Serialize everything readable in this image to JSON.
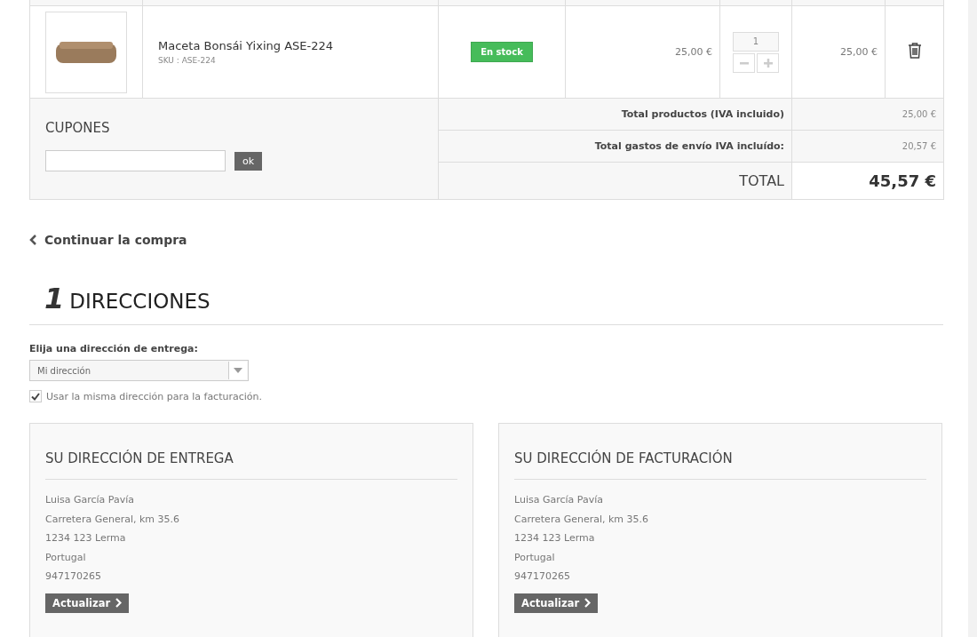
{
  "cart": {
    "items": [
      {
        "name": "Maceta Bonsái Yixing ASE-224",
        "sku": "SKU : ASE-224",
        "stock": "En stock",
        "unit_price": "25,00 €",
        "quantity": "1",
        "total": "25,00 €"
      }
    ],
    "coupons": {
      "title": "CUPONES",
      "button": "ok"
    },
    "totals": [
      {
        "kind": "line",
        "label": "Total productos (IVA incluido)",
        "value": "25,00 €"
      },
      {
        "kind": "line",
        "label": "Total gastos de envío IVA incluído:",
        "value": "20,57 €"
      },
      {
        "kind": "grand",
        "label": "TOTAL",
        "value": "45,57 €"
      }
    ]
  },
  "continue_link": "Continuar la compra",
  "section": {
    "number": "1",
    "title": "DIRECCIONES"
  },
  "delivery_select": {
    "label": "Elija una dirección de entrega:",
    "value": "Mi dirección"
  },
  "same_billing": {
    "label": "Usar la misma dirección para la facturación.",
    "checked": true
  },
  "addresses": [
    {
      "title": "SU DIRECCIÓN DE ENTREGA",
      "lines": [
        "Luisa García Pavía",
        "Carretera General, km 35.6",
        "1234 123 Lerma",
        "Portugal",
        "947170265"
      ],
      "button": "Actualizar"
    },
    {
      "title": "SU DIRECCIÓN DE FACTURACIÓN",
      "lines": [
        "Luisa García Pavía",
        "Carretera General, km 35.6",
        "1234 123 Lerma",
        "Portugal",
        "947170265"
      ],
      "button": "Actualizar"
    }
  ]
}
